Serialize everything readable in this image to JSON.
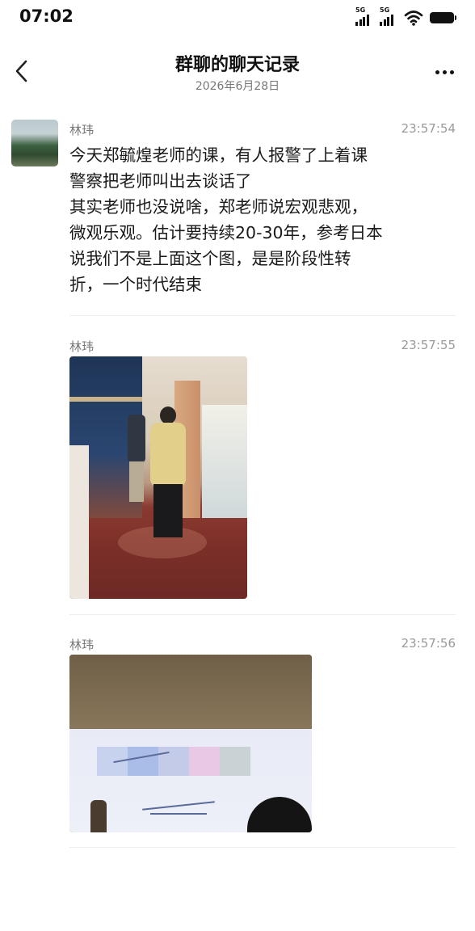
{
  "status_bar": {
    "time": "07:02",
    "network_1": "5G",
    "network_2": "5G",
    "icons": [
      "signal-icon",
      "signal-icon",
      "wifi-icon",
      "battery-icon"
    ]
  },
  "header": {
    "back_icon": "chevron-left-icon",
    "title": "群聊的聊天记录",
    "date": "2026年6月28日",
    "more_icon": "more-dots-icon"
  },
  "messages": [
    {
      "sender": "林玮",
      "time": "23:57:54",
      "lines": [
        "今天郑毓煌老师的课，有人报警了上着课",
        "警察把老师叫出去谈话了",
        "其实老师也没说啥，郑老师说宏观悲观，",
        "微观乐观。估计要持续20-30年，参考日本",
        "说我们不是上面这个图，是是阶段性转",
        "折，一个时代结束"
      ]
    },
    {
      "sender": "林玮",
      "time": "23:57:55",
      "image": "photo-of-people-in-hotel-lobby"
    },
    {
      "sender": "林玮",
      "time": "23:57:56",
      "image": "photo-of-presentation-slide"
    }
  ],
  "colors": {
    "background": "#ffffff",
    "text": "#1a1a1a",
    "secondary_text": "#777777",
    "divider": "#eeeeee"
  }
}
